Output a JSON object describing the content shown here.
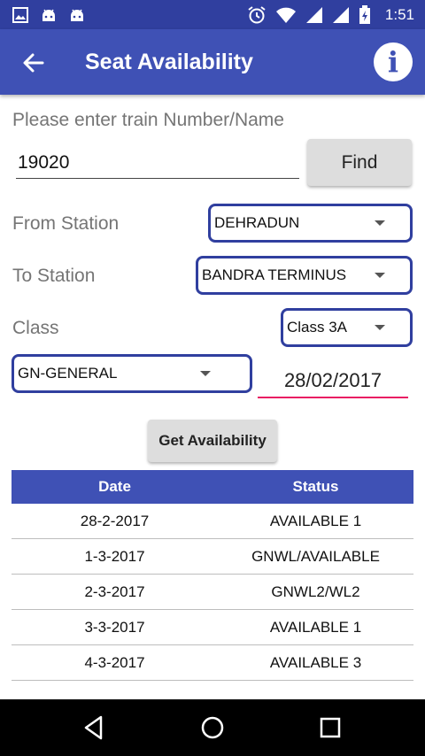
{
  "status_bar": {
    "time": "1:51",
    "left_icons": [
      "image-icon",
      "android-icon",
      "android-icon"
    ],
    "right_icons": [
      "alarm-icon",
      "wifi-icon",
      "signal-icon",
      "signal-icon",
      "battery-charging-icon"
    ]
  },
  "app_bar": {
    "title": "Seat Availability",
    "background": "#3F51B5",
    "status_background": "#303F9F"
  },
  "form": {
    "prompt": "Please enter train Number/Name",
    "train_number": "19020",
    "find_label": "Find",
    "from_label": "From Station",
    "from_value": "DEHRADUN",
    "to_label": "To Station",
    "to_value": "BANDRA TERMINUS",
    "class_label": "Class",
    "class_value": "Class 3A",
    "quota_value": "GN-GENERAL",
    "date_value": "28/02/2017",
    "get_availability_label": "Get Availability",
    "accent_color": "#E91E63"
  },
  "table": {
    "headers": [
      "Date",
      "Status"
    ],
    "rows": [
      {
        "date": "28-2-2017",
        "status": "AVAILABLE 1"
      },
      {
        "date": "1-3-2017",
        "status": "GNWL/AVAILABLE"
      },
      {
        "date": "2-3-2017",
        "status": "GNWL2/WL2"
      },
      {
        "date": "3-3-2017",
        "status": "AVAILABLE 1"
      },
      {
        "date": "4-3-2017",
        "status": "AVAILABLE 3"
      }
    ]
  },
  "nav_bar": [
    "back-triangle-icon",
    "home-circle-icon",
    "recents-square-icon"
  ]
}
